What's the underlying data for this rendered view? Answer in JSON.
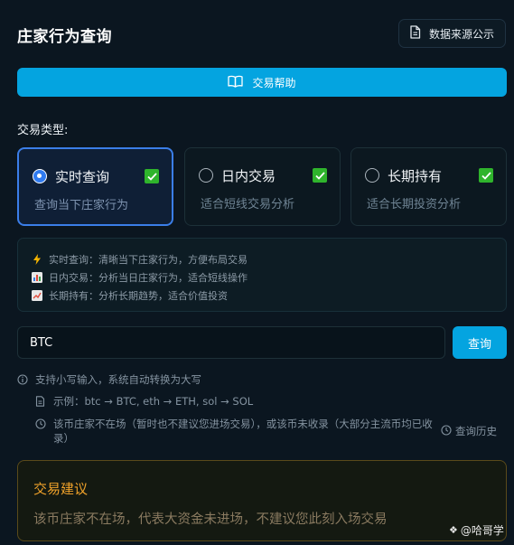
{
  "header": {
    "title": "庄家行为查询",
    "source_button": "数据来源公示",
    "source_icon": "document-icon"
  },
  "help_button": {
    "label": "交易帮助",
    "icon": "book-icon"
  },
  "trade_type": {
    "label": "交易类型:",
    "options": [
      {
        "name": "实时查询",
        "desc": "查询当下庄家行为",
        "selected": true,
        "checked": true
      },
      {
        "name": "日内交易",
        "desc": "适合短线交易分析",
        "selected": false,
        "checked": true
      },
      {
        "name": "长期持有",
        "desc": "适合长期投资分析",
        "selected": false,
        "checked": true
      }
    ]
  },
  "info": {
    "lines": [
      {
        "icon": "lightning-icon",
        "text": "实时查询：清晰当下庄家行为，方便布局交易"
      },
      {
        "icon": "bar-chart-icon",
        "text": "日内交易：分析当日庄家行为，适合短线操作"
      },
      {
        "icon": "line-chart-icon",
        "text": "长期持有：分析长期趋势，适合价值投资"
      }
    ]
  },
  "search": {
    "value": "BTC",
    "button": "查询"
  },
  "hints": {
    "uppercase": "支持小写输入，系统自动转换为大写",
    "example": "示例：btc → BTC, eth → ETH, sol → SOL",
    "status": "该币庄家不在场（暂时也不建议您进场交易），或该币未收录（大部分主流币均已收录）",
    "history": "查询历史"
  },
  "advice": {
    "title": "交易建议",
    "text": "该币庄家不在场，代表大资金未进场，不建议您此刻入场交易"
  },
  "watermark": {
    "text": "@哈哥学"
  },
  "colors": {
    "accent": "#04a4e0",
    "selected_border": "#3b7ee8",
    "check_green": "#2fb42c",
    "advice_title": "#f0a22a",
    "background": "#0b1620"
  }
}
